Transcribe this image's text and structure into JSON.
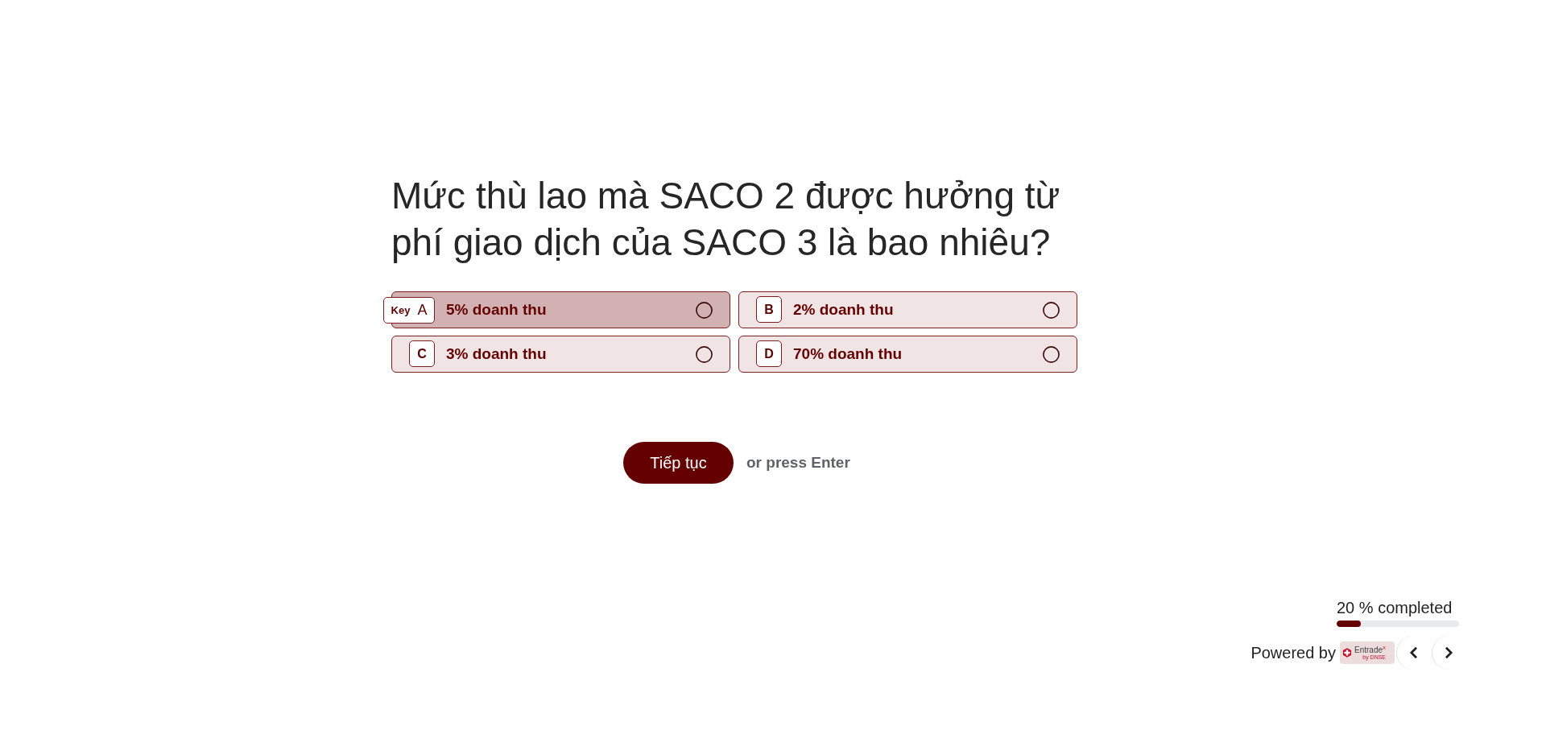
{
  "question": "Mức thù lao mà SACO 2 được hưởng từ phí giao dịch của SACO 3 là bao nhiêu?",
  "options": [
    {
      "letter": "A",
      "key_hint": "Key",
      "label": "5% doanh thu",
      "focused": true,
      "selected": false
    },
    {
      "letter": "B",
      "label": "2% doanh thu",
      "focused": false,
      "selected": false
    },
    {
      "letter": "C",
      "label": "3% doanh thu",
      "focused": false,
      "selected": false
    },
    {
      "letter": "D",
      "label": "70% doanh thu",
      "focused": false,
      "selected": false
    }
  ],
  "continue_button": {
    "label": "Tiếp tục"
  },
  "enter_hint": "or press Enter",
  "progress": {
    "label": "20 % completed",
    "level": 0.2
  },
  "footer": {
    "powered_by": "Powered by",
    "logo": {
      "name": "Entrade$^{X}$",
      "tagline": "by DNSE"
    }
  }
}
